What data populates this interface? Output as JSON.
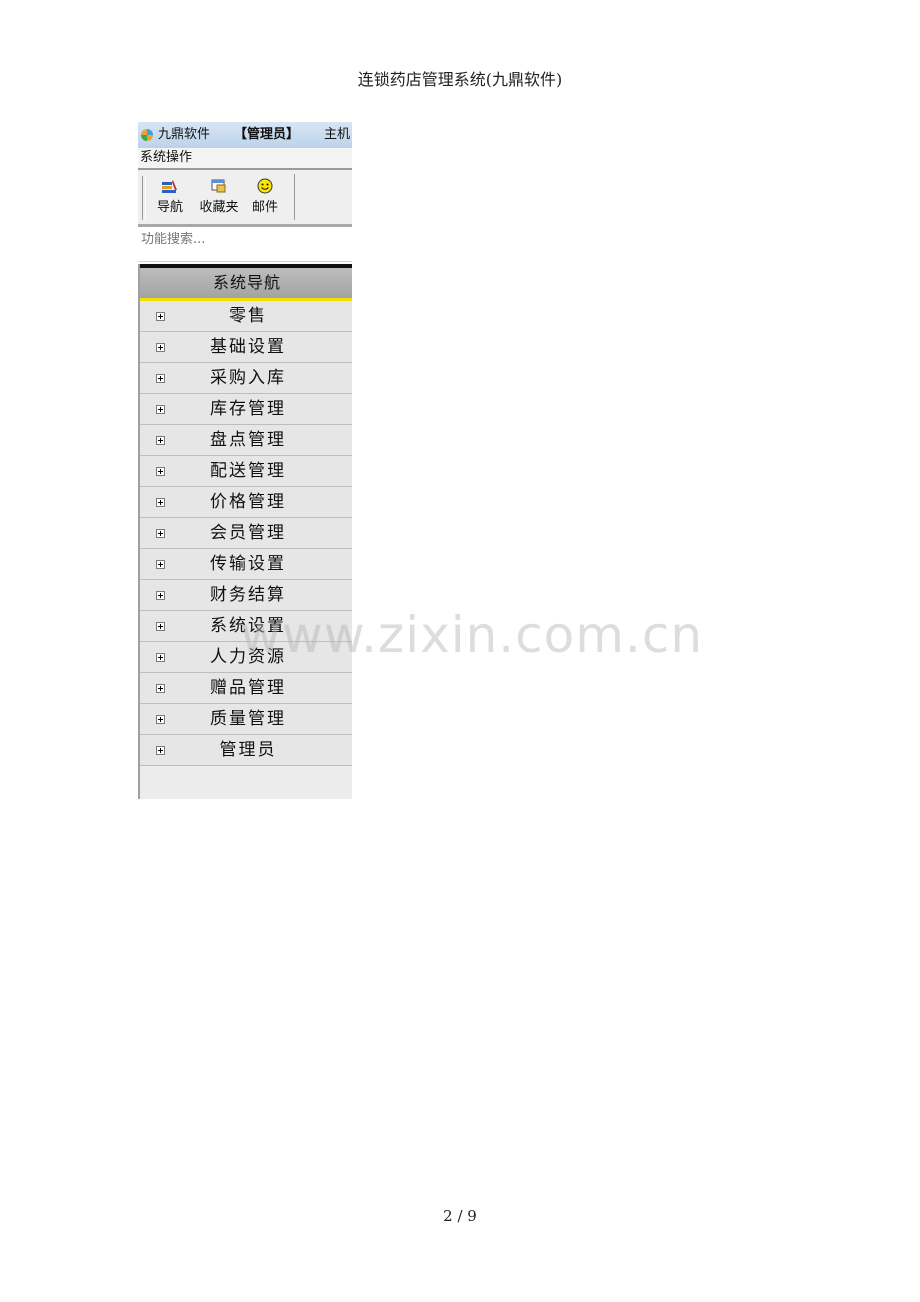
{
  "document": {
    "header": "连锁药店管理系统(九鼎软件)",
    "footer": "2  / 9",
    "watermark": "www.zixin.com.cn"
  },
  "window": {
    "app_name": "九鼎软件",
    "role": "【管理员】",
    "host": "主机"
  },
  "menu": {
    "system_ops": "系统操作"
  },
  "toolbar": {
    "items": [
      {
        "label": "导航",
        "icon": "books-icon"
      },
      {
        "label": "收藏夹",
        "icon": "folder-window-icon"
      },
      {
        "label": "邮件",
        "icon": "smiley-icon"
      }
    ]
  },
  "search": {
    "placeholder": "功能搜索..."
  },
  "nav": {
    "header": "系统导航",
    "items": [
      {
        "label": "零售"
      },
      {
        "label": "基础设置"
      },
      {
        "label": "采购入库"
      },
      {
        "label": "库存管理"
      },
      {
        "label": "盘点管理"
      },
      {
        "label": "配送管理"
      },
      {
        "label": "价格管理"
      },
      {
        "label": "会员管理"
      },
      {
        "label": "传输设置"
      },
      {
        "label": "财务结算"
      },
      {
        "label": "系统设置"
      },
      {
        "label": "人力资源"
      },
      {
        "label": "赠品管理"
      },
      {
        "label": "质量管理"
      },
      {
        "label": "管理员"
      }
    ]
  }
}
